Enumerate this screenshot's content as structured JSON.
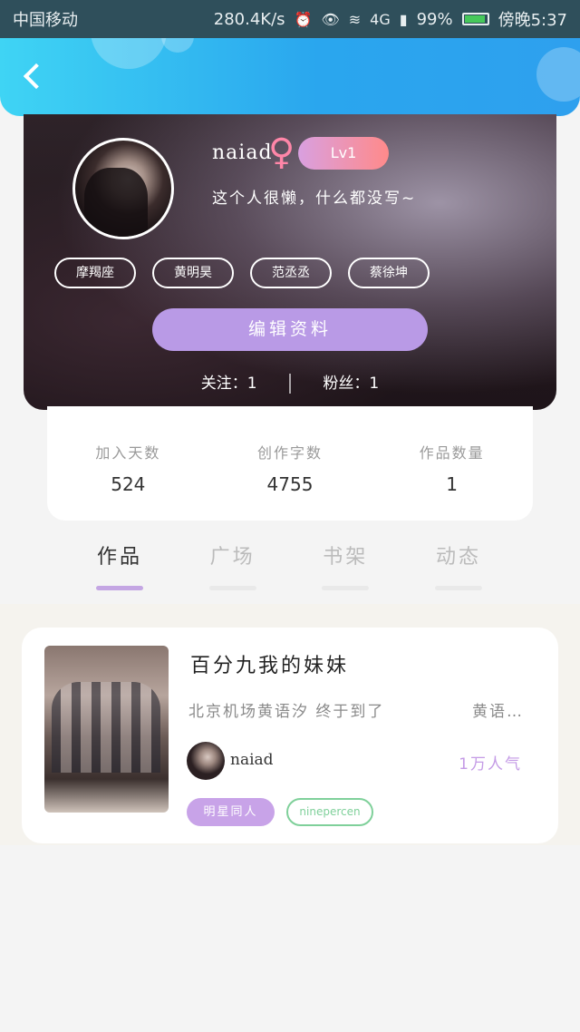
{
  "status_bar": {
    "carrier": "中国移动",
    "speed": "280.4K/s",
    "network": "4G",
    "battery": "99%",
    "time": "傍晚5:37"
  },
  "profile": {
    "username": "naiad",
    "gender_symbol": "♀",
    "level": "Lv1",
    "bio": "这个人很懒，什么都没写~",
    "tags": [
      "摩羯座",
      "黄明昊",
      "范丞丞",
      "蔡徐坤"
    ],
    "edit_button": "编辑资料",
    "following_label": "关注：1",
    "followers_label": "粉丝：1"
  },
  "stats": [
    {
      "label": "加入天数",
      "value": "524"
    },
    {
      "label": "创作字数",
      "value": "4755"
    },
    {
      "label": "作品数量",
      "value": "1"
    }
  ],
  "tabs": [
    {
      "label": "作品",
      "active": true
    },
    {
      "label": "广场",
      "active": false
    },
    {
      "label": "书架",
      "active": false
    },
    {
      "label": "动态",
      "active": false
    }
  ],
  "work": {
    "title": "百分九我的妹妹",
    "description": "北京机场黄语汐 终于到了",
    "description_more": "黄语…",
    "author": "naiad",
    "popularity": "1万人气",
    "tag_primary": "明星同人",
    "tag_secondary": "ninepercen"
  },
  "colors": {
    "header_start": "#3fd4f4",
    "header_end": "#2ea0ee",
    "accent_purple": "#b99ae6",
    "tag_green": "#7fd09a"
  }
}
